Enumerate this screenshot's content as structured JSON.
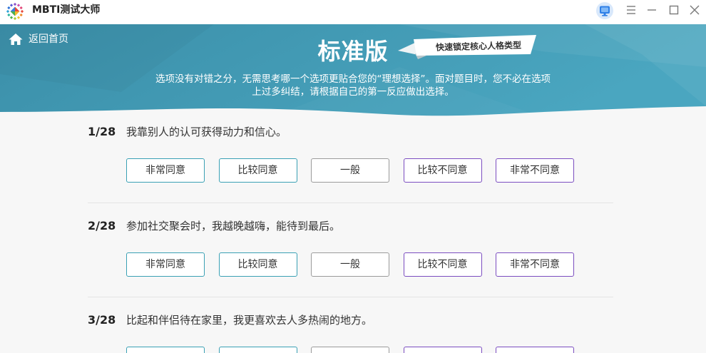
{
  "window": {
    "app_title": "MBTI测试大师",
    "icons": {
      "logo": "mbti-logo-icon",
      "monitor": "monitor-icon",
      "menu": "hamburger-menu-icon",
      "minimize": "minimize-icon",
      "maximize": "maximize-icon",
      "close": "close-icon"
    }
  },
  "header": {
    "back_icon": "home-icon",
    "back_label": "返回首页",
    "title": "标准版",
    "ribbon_label": "快速锁定核心人格类型",
    "description_lines": [
      "选项没有对错之分，无需思考哪一个选项更贴合您的“理想选择”。面对题目时，您不必在选项",
      "上过多纠结，请根据自己的第一反应做出选择。"
    ]
  },
  "colors": {
    "header-dark": "#3b8fa9",
    "header-light": "#4aa6c0",
    "agree": "#3aa0b4",
    "neutral": "#9b9b9b",
    "disagree": "#7b4dc0",
    "monitor": "#2f80e7",
    "divider": "#e4e4e4"
  },
  "questions": [
    {
      "number": "1/28",
      "text": "我靠别人的认可获得动力和信心。",
      "options": [
        "非常同意",
        "比较同意",
        "一般",
        "比较不同意",
        "非常不同意"
      ]
    },
    {
      "number": "2/28",
      "text": "参加社交聚会时，我越晚越嗨，能待到最后。",
      "options": [
        "非常同意",
        "比较同意",
        "一般",
        "比较不同意",
        "非常不同意"
      ]
    },
    {
      "number": "3/28",
      "text": "比起和伴侣待在家里，我更喜欢去人多热闹的地方。"
    }
  ]
}
